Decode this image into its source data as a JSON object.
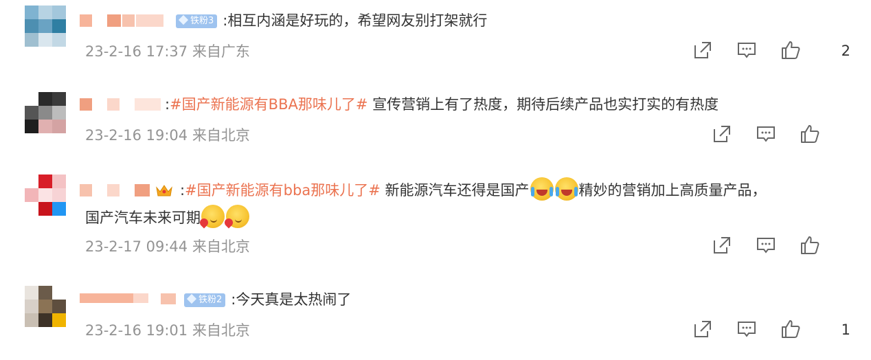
{
  "comments": [
    {
      "badge": "铁粉3",
      "prefix": ":",
      "text": "相互内涵是好玩的，希望网友别打架就行",
      "time": "23-2-16 17:37",
      "location": "来自广东",
      "likes": "2"
    },
    {
      "prefix": ":",
      "topic": "#国产新能源有BBA那味儿了#",
      "text": " 宣传营销上有了热度，期待后续产品也实打实的有热度",
      "time": "23-2-16 19:04",
      "location": "来自北京",
      "likes": ""
    },
    {
      "prefix": ":",
      "topic": "#国产新能源有bba那味儿了#",
      "text_a": " 新能源汽车还得是国产",
      "text_b": "精妙的营销加上高质量产品，",
      "text_c": "国产汽车未来可期",
      "time": "23-2-17 09:44",
      "location": "来自北京",
      "likes": ""
    },
    {
      "badge": "铁粉2",
      "prefix": ":",
      "text": "今天真是太热闹了",
      "time": "23-2-16 19:01",
      "location": "来自北京",
      "likes": "1"
    }
  ],
  "icons": {
    "share": "share-icon",
    "comment": "comment-icon",
    "like": "thumbs-up-icon",
    "crown": "crown-icon",
    "emoji_cry_laugh": "crying-laughing-face-icon",
    "emoji_heart": "heart-face-icon"
  },
  "colors": {
    "topic": "#eb7350",
    "meta": "#939393",
    "badge": "#9ec3ef"
  }
}
